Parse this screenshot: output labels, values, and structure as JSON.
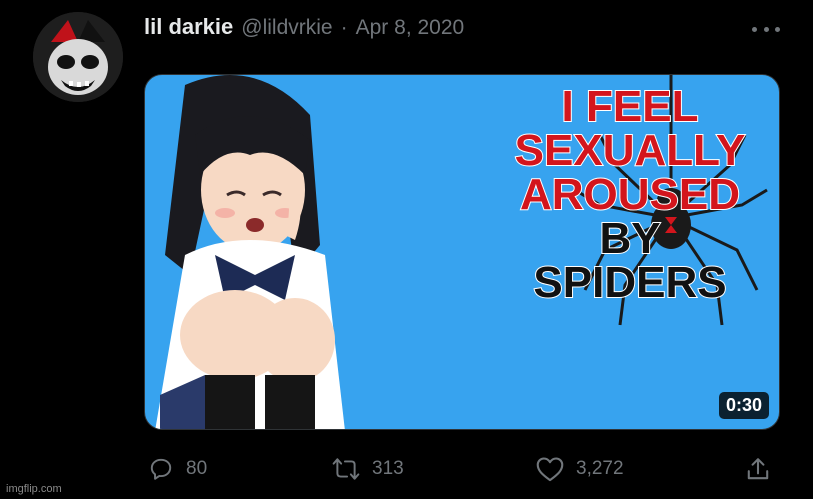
{
  "tweet": {
    "author_name": "lil darkie",
    "handle": "@lildvrkie",
    "separator": "·",
    "date": "Apr 8, 2020"
  },
  "media": {
    "meme_lines_red": [
      "I FEEL",
      "SEXUALLY",
      "AROUSED"
    ],
    "meme_lines_black": [
      "BY",
      "SPIDERS"
    ],
    "duration": "0:30",
    "background_color": "#37a3ef"
  },
  "actions": {
    "replies": "80",
    "retweets": "313",
    "likes": "3,272"
  },
  "icons": [
    "more-icon",
    "reply-icon",
    "retweet-icon",
    "like-icon",
    "share-icon"
  ],
  "watermark": "imgflip.com"
}
